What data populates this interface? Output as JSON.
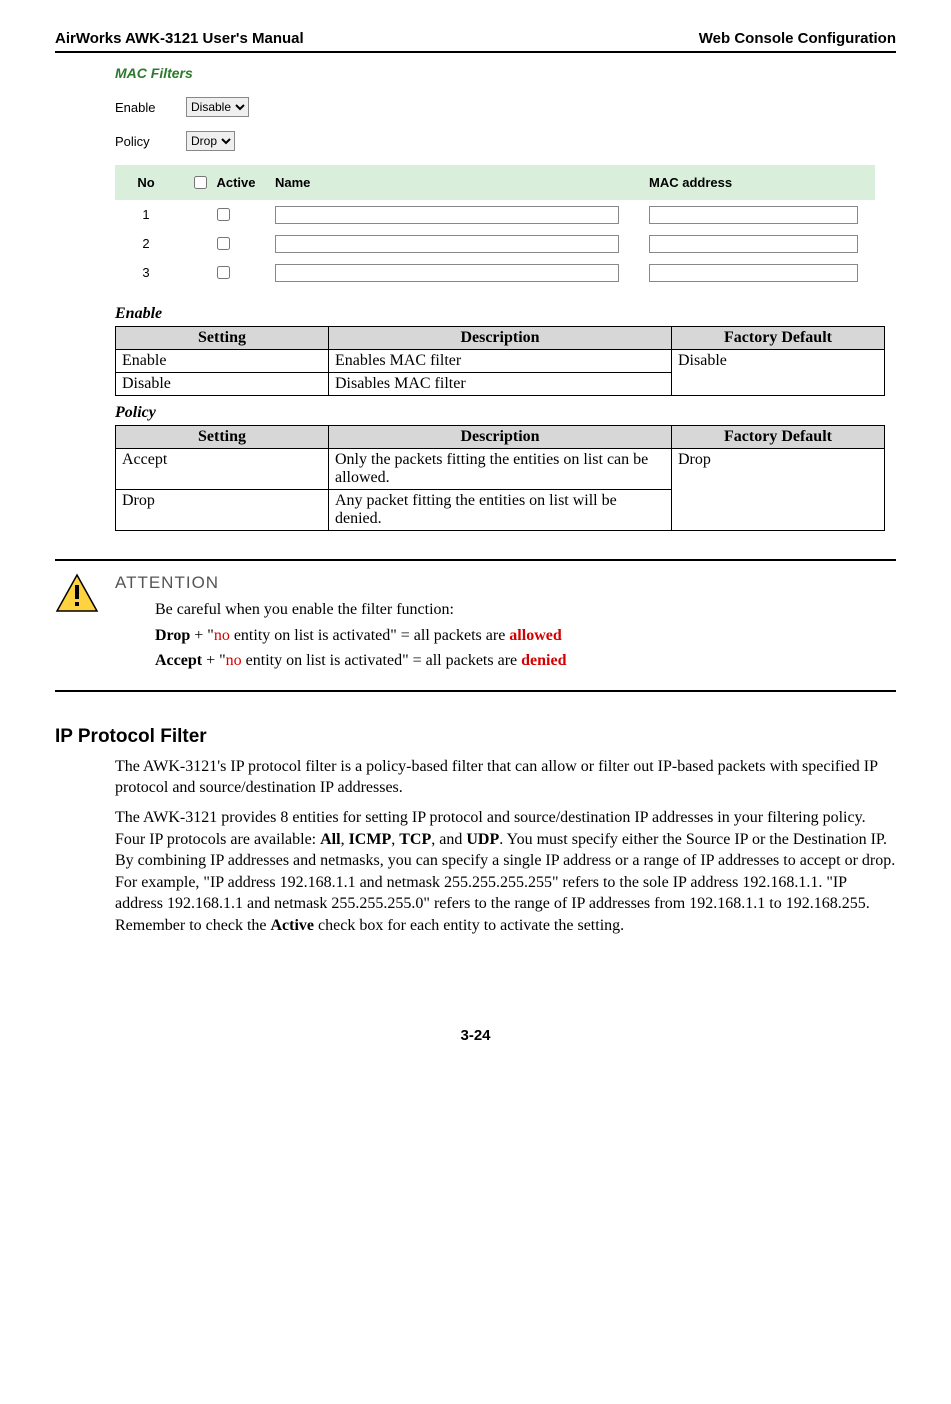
{
  "header": {
    "left": "AirWorks AWK-3121 User's Manual",
    "right": "Web Console Configuration"
  },
  "screenshot": {
    "title": "MAC Filters",
    "enable_label": "Enable",
    "policy_label": "Policy",
    "enable_value": "Disable",
    "policy_value": "Drop",
    "cols": {
      "no": "No",
      "active": "Active",
      "name": "Name",
      "mac": "MAC address"
    },
    "rows": [
      {
        "no": "1"
      },
      {
        "no": "2"
      },
      {
        "no": "3"
      }
    ]
  },
  "enable_table": {
    "heading": "Enable",
    "cols": {
      "setting": "Setting",
      "desc": "Description",
      "def": "Factory Default"
    },
    "rows": [
      {
        "setting": "Enable",
        "desc": "Enables MAC filter"
      },
      {
        "setting": "Disable",
        "desc": "Disables MAC filter"
      }
    ],
    "default": "Disable"
  },
  "policy_table": {
    "heading": "Policy",
    "cols": {
      "setting": "Setting",
      "desc": "Description",
      "def": "Factory Default"
    },
    "rows": [
      {
        "setting": "Accept",
        "desc": "Only the packets fitting the entities on list can be allowed."
      },
      {
        "setting": "Drop",
        "desc": "Any packet fitting the entities on list will be denied."
      }
    ],
    "default": "Drop"
  },
  "attention": {
    "title": "ATTENTION",
    "intro": "Be careful when you enable the filter function:",
    "line1_pre": "Drop",
    "line1_mid1": " + \"",
    "line1_red1": "no",
    "line1_mid2": " entity on list is activated\" = all packets are ",
    "line1_red2": "allowed",
    "line2_pre": "Accept",
    "line2_mid1": " + \"",
    "line2_red1": "no",
    "line2_mid2": " entity on list is activated\" = all packets are ",
    "line2_red2": "denied"
  },
  "ipfilter": {
    "heading": "IP Protocol Filter",
    "p1": "The AWK-3121's IP protocol filter is a policy-based filter that can allow or filter out IP-based packets with specified IP protocol and source/destination IP addresses.",
    "p2a": "The AWK-3121 provides 8 entities for setting IP protocol and source/destination IP addresses in your filtering policy. Four IP protocols are available: ",
    "p2_all": "All",
    "p2_c1": ", ",
    "p2_icmp": "ICMP",
    "p2_c2": ", ",
    "p2_tcp": "TCP",
    "p2_c3": ", and ",
    "p2_udp": "UDP",
    "p2b": ". You must specify either the Source IP or the Destination IP. By combining IP addresses and netmasks, you can specify a single IP address or a range of IP addresses to accept or drop. For example, \"IP address 192.168.1.1 and netmask 255.255.255.255\" refers to the sole IP address 192.168.1.1. \"IP address 192.168.1.1 and netmask 255.255.255.0\" refers to the range of IP addresses from 192.168.1.1 to 192.168.255. Remember to check the ",
    "p2_active": "Active",
    "p2c": " check box for each entity to activate the setting."
  },
  "footer": "3-24"
}
